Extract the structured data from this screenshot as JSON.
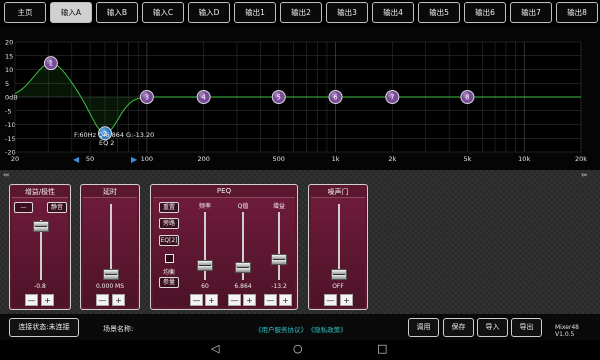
{
  "tabs": [
    "主页",
    "输入A",
    "输入B",
    "输入C",
    "输入D",
    "输出1",
    "输出2",
    "输出3",
    "输出4",
    "输出5",
    "输出6",
    "输出7",
    "输出8"
  ],
  "active_tab": 1,
  "graph": {
    "y_ticks": [
      "20",
      "15",
      "10",
      "5",
      "0dB",
      "-5",
      "-10",
      "-15",
      "-20"
    ],
    "x_ticks": [
      "20",
      "50",
      "100",
      "200",
      "500",
      "1k",
      "2k",
      "5k",
      "10k",
      "20k"
    ],
    "readout_line1": "F:60Hz Q:6.864 G:-13.20",
    "readout_line2": "EQ 2",
    "points": [
      {
        "label": "1",
        "freq": 31,
        "gain": 12.3,
        "color": "#7a4a9a"
      },
      {
        "label": "2",
        "freq": 60,
        "gain": -13.2,
        "color": "#2d7ec9"
      },
      {
        "label": "3",
        "freq": 100,
        "gain": 0,
        "color": "#7a4a9a"
      },
      {
        "label": "4",
        "freq": 200,
        "gain": 0,
        "color": "#7a4a9a"
      },
      {
        "label": "5",
        "freq": 500,
        "gain": 0,
        "color": "#7a4a9a"
      },
      {
        "label": "6",
        "freq": 1000,
        "gain": 0,
        "color": "#7a4a9a"
      },
      {
        "label": "7",
        "freq": 2000,
        "gain": 0,
        "color": "#7a4a9a"
      },
      {
        "label": "8",
        "freq": 5000,
        "gain": 0,
        "color": "#7a4a9a"
      }
    ],
    "curve_color": "#3fbf3f"
  },
  "nav": {
    "left": "‹‹‹",
    "right": "›››"
  },
  "gain_panel": {
    "title": "增益/极性",
    "polarity_btn": "—",
    "mute_btn": "静音",
    "value": "-0.8",
    "minus": "—",
    "plus": "+",
    "level": 0.85
  },
  "delay_panel": {
    "title": "延时",
    "value": "0.000 MS",
    "minus": "—",
    "plus": "+",
    "level": 0.0
  },
  "peq_panel": {
    "title": "PEQ",
    "reset_btn": "重置",
    "bypass_btn": "旁路",
    "eq_btn": "EQ[2]",
    "linkage_label": "均衡",
    "param_btn": "参量",
    "freq_label": "频率",
    "q_label": "Q值",
    "gain_label": "增益",
    "freq_value": "60",
    "q_value": "6.864",
    "gain_value": "-13.2",
    "minus": "—",
    "plus": "+"
  },
  "gate_panel": {
    "title": "噪声门",
    "value": "OFF",
    "minus": "—",
    "plus": "+",
    "level": 0.0
  },
  "bottom": {
    "connect_btn": "连接状态:未连接",
    "scene_label": "场景名称:",
    "link_agreement": "《用户服务协议》",
    "link_privacy": "《隐私政策》",
    "load_btn": "调用",
    "save_btn": "保存",
    "import_btn": "导入",
    "export_btn": "导出",
    "version": "Mixer48 V1.0.5"
  }
}
